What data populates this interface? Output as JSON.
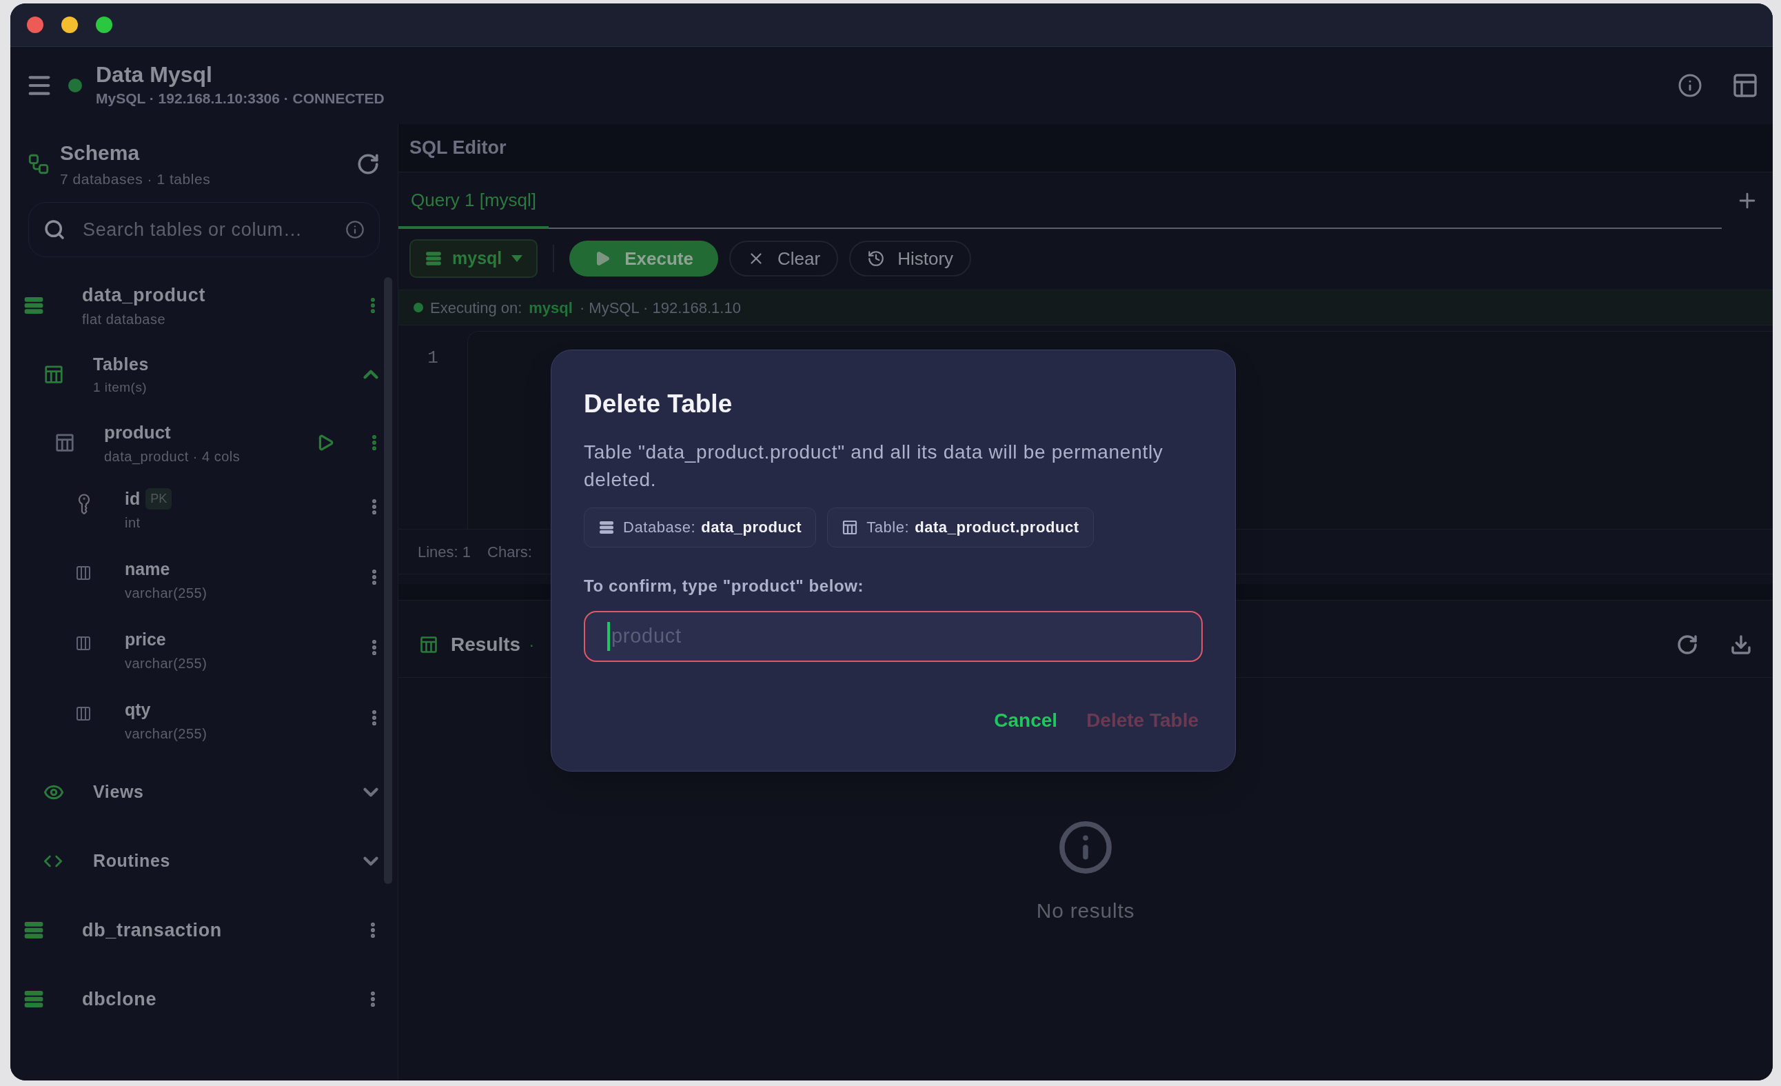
{
  "header": {
    "title": "Data Mysql",
    "subtitle": "MySQL · 192.168.1.10:3306 · CONNECTED",
    "connected": true
  },
  "schema": {
    "title": "Schema",
    "summary": "7 databases · 1 tables",
    "search": {
      "placeholder": "Search tables or colum…"
    }
  },
  "databases": [
    {
      "name": "data_product",
      "subtitle": "flat database",
      "groups": [
        {
          "kind": "tables",
          "label": "Tables",
          "count": "1 item(s)",
          "expanded": true,
          "children": [
            {
              "name": "product",
              "subtitle": "data_product · 4 cols",
              "children": [
                {
                  "kind": "key",
                  "name": "id",
                  "type": "int",
                  "badge": "PK"
                },
                {
                  "kind": "column",
                  "name": "name",
                  "type": "varchar(255)"
                },
                {
                  "kind": "column",
                  "name": "price",
                  "type": "varchar(255)"
                },
                {
                  "kind": "column",
                  "name": "qty",
                  "type": "varchar(255)"
                }
              ]
            }
          ]
        },
        {
          "kind": "views",
          "label": "Views",
          "expanded": false
        },
        {
          "kind": "routines",
          "label": "Routines",
          "expanded": false
        }
      ]
    },
    {
      "name": "db_transaction"
    },
    {
      "name": "dbclone"
    }
  ],
  "editor": {
    "title": "SQL Editor",
    "tabs": [
      {
        "label": "Query 1 [mysql]",
        "selected": true
      }
    ],
    "connection_select": "mysql",
    "buttons": [
      {
        "kind": "execute",
        "label": "Execute"
      },
      {
        "kind": "clear",
        "label": "Clear"
      },
      {
        "kind": "history",
        "label": "History"
      }
    ],
    "executing": {
      "label": "Executing on:",
      "db": "mysql",
      "detail": "· MySQL · 192.168.1.10"
    },
    "line_numbers": [
      "1"
    ],
    "footer": [
      "Lines: 1",
      "Chars:"
    ]
  },
  "results": {
    "title": "Results",
    "separator": "·",
    "empty_text": "No results"
  },
  "dialog": {
    "title": "Delete Table",
    "message": "Table \"data_product.product\" and all its data will be permanently deleted.",
    "chips": [
      {
        "kind": "database",
        "label": "Database:",
        "value": "data_product"
      },
      {
        "kind": "table",
        "label": "Table:",
        "value": "data_product.product"
      }
    ],
    "confirm_label": "To confirm, type \"product\" below:",
    "input": {
      "placeholder": "product"
    },
    "cancel": "Cancel",
    "delete": {
      "label": "Delete Table",
      "disabled": true
    }
  }
}
